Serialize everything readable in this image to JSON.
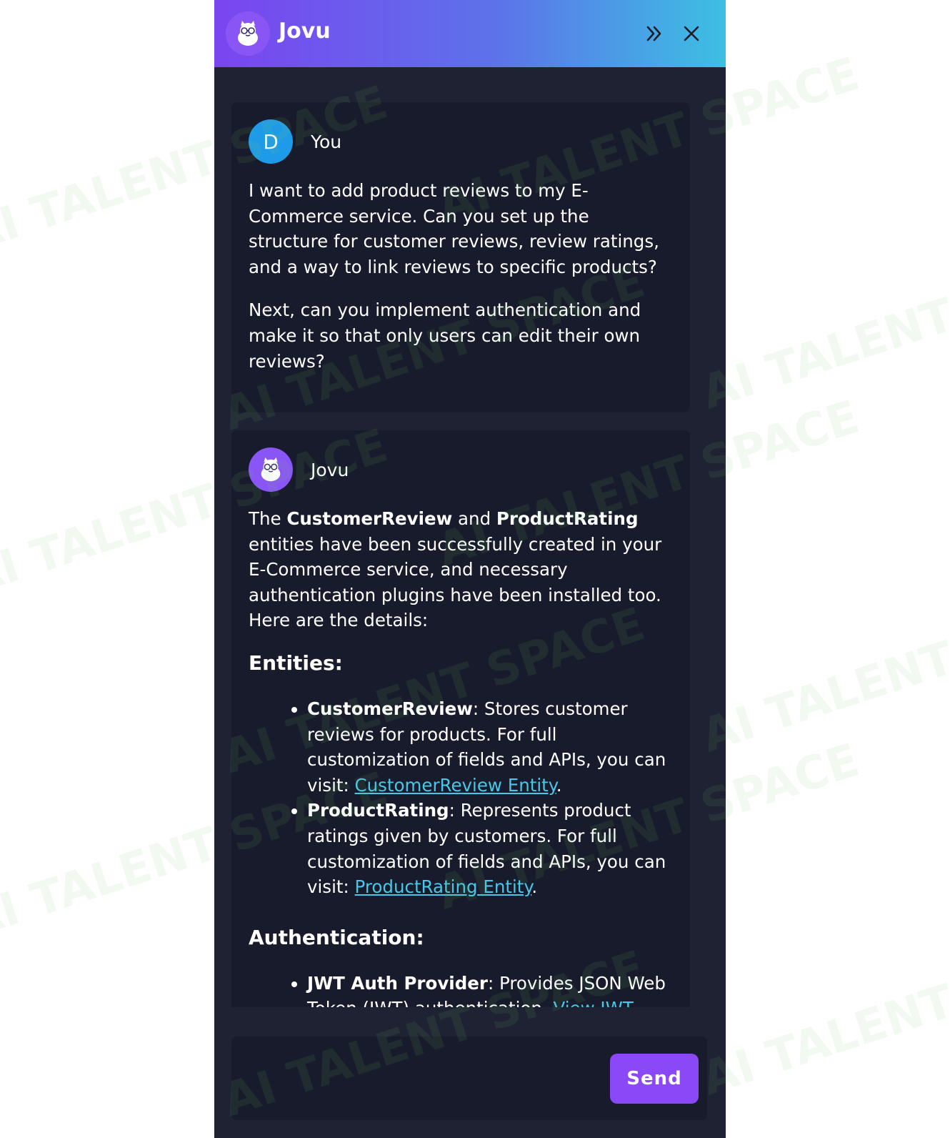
{
  "header": {
    "title": "Jovu",
    "expand_icon": "double-chevron-right-icon",
    "close_icon": "close-icon"
  },
  "messages": {
    "user": {
      "avatar_letter": "D",
      "sender": "You",
      "paragraphs": [
        "I want to add product reviews to my E-Commerce service. Can you set up the structure for customer reviews, review ratings, and a way to link reviews to specific products?",
        "Next, can you implement authentication and make it so that only users can edit their own reviews?"
      ]
    },
    "bot": {
      "sender": "Jovu",
      "intro": {
        "t1": "The ",
        "b1": "CustomerReview",
        "t2": " and ",
        "b2": "ProductRating",
        "t3": " entities have been successfully created in your E-Commerce service, and necessary authentication plugins have been installed too. Here are the details:"
      },
      "entities_heading": "Entities:",
      "entities": [
        {
          "name": "CustomerReview",
          "text": ": Stores customer reviews for products. For full customization of fields and APIs, you can visit: ",
          "link": "CustomerReview Entity",
          "tail": "."
        },
        {
          "name": "ProductRating",
          "text": ": Represents product ratings given by customers. For full customization of fields and APIs, you can visit: ",
          "link": "ProductRating Entity",
          "tail": "."
        }
      ],
      "auth_heading": "Authentication:",
      "auth_items": [
        {
          "name": "JWT Auth Provider",
          "text": ": Provides JSON Web Token (JWT) authentication. ",
          "link": "View JWT"
        }
      ]
    }
  },
  "composer": {
    "placeholder": "",
    "send_label": "Send"
  },
  "watermark": {
    "text": "AI TALENT SPACE"
  },
  "colors": {
    "panel_bg": "#1f2233",
    "card_bg": "#181b2b",
    "accent": "#8a48f6",
    "link": "#47c8e8",
    "user_avatar": "#1e9be8"
  }
}
